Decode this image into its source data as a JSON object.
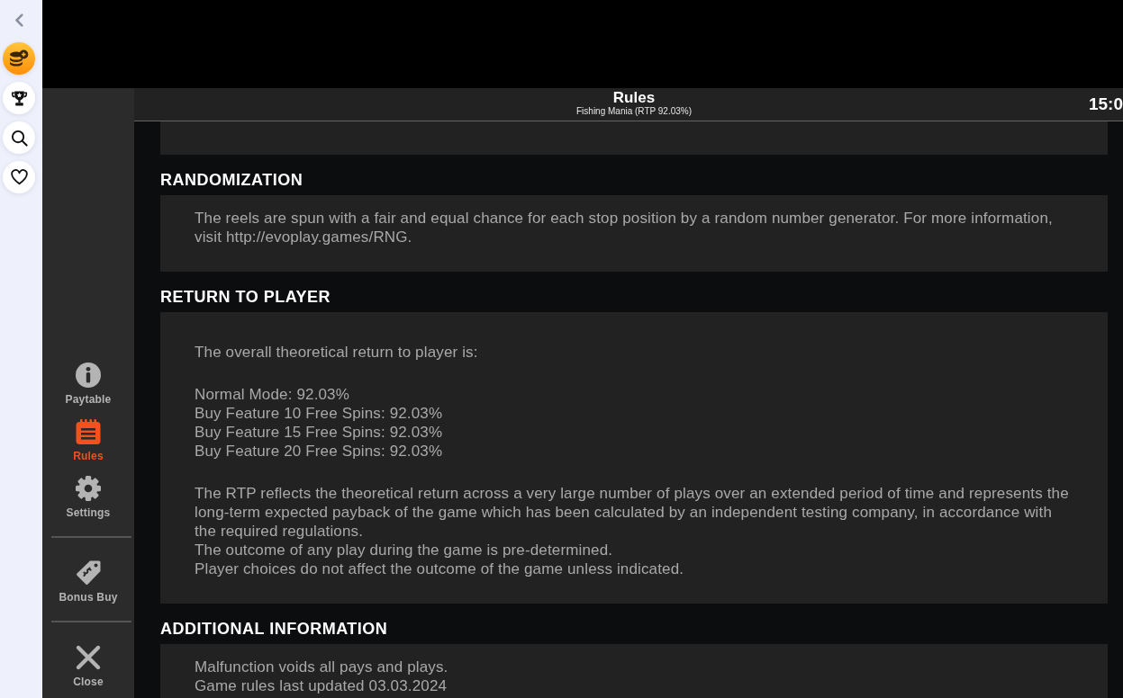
{
  "side_rail": {
    "buttons": [
      {
        "selected": true
      },
      {
        "selected": false
      },
      {
        "selected": false
      },
      {
        "selected": false
      }
    ]
  },
  "menu": {
    "items": [
      {
        "label": "Paytable",
        "selected": false
      },
      {
        "label": "Rules",
        "selected": true
      },
      {
        "label": "Settings",
        "selected": false
      }
    ],
    "actions": [
      {
        "label": "Bonus Buy"
      },
      {
        "label": "Close"
      }
    ]
  },
  "header": {
    "title": "Rules",
    "subtitle": "Fishing Mania (RTP 92.03%)",
    "clock": "15:0"
  },
  "sections": [
    {
      "heading": "RANDOMIZATION",
      "paragraphs": [
        [
          "The reels are spun with a fair and equal chance for each stop position by a random number generator. For more information, visit http://evoplay.games/RNG."
        ]
      ]
    },
    {
      "heading": "RETURN TO PLAYER",
      "paragraphs": [
        [
          "The overall theoretical return to player is:"
        ],
        [
          "Normal Mode: 92.03%",
          "Buy Feature 10 Free Spins: 92.03%",
          "Buy Feature 15 Free Spins: 92.03%",
          "Buy Feature 20 Free Spins: 92.03%"
        ],
        [
          "The RTP reflects the theoretical return across a very large number of plays over an extended period of time and represents the long-term expected payback of the game which has been calculated by an independent testing company, in accordance with the required regulations.",
          "The outcome of any play during the game is pre-determined.",
          "Player choices do not affect the outcome of the game unless indicated."
        ]
      ]
    },
    {
      "heading": "ADDITIONAL INFORMATION",
      "paragraphs": [
        [
          "Malfunction voids all pays and plays.",
          "Game rules last updated 03.03.2024"
        ]
      ]
    }
  ]
}
